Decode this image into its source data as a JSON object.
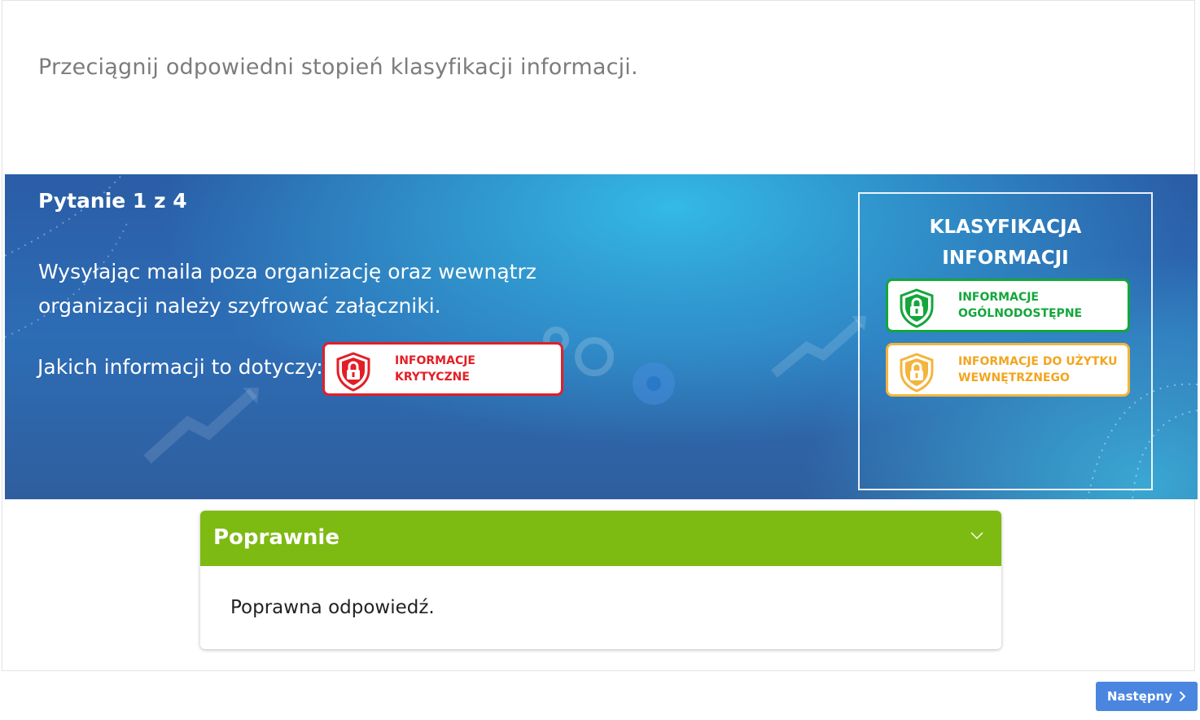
{
  "instruction": "Przeciągnij odpowiedni stopień klasyfikacji informacji.",
  "question": {
    "title": "Pytanie 1 z 4",
    "text": "Wysyłając maila poza organizację oraz wewnątrz organizacji należy szyfrować załączniki.",
    "ask": "Jakich informacji to dotyczy:"
  },
  "dropped_answer": {
    "line1": "INFORMACJE",
    "line2": "KRYTYCZNE",
    "color": "#e41e26",
    "icon": "lock-shield-icon"
  },
  "classification_panel": {
    "title_line1": "KLASYFIKACJA",
    "title_line2": "INFORMACJI",
    "options": [
      {
        "line1": "INFORMACJE",
        "line2": "OGÓLNODOSTĘPNE",
        "color": "#14a63c",
        "icon": "lock-shield-icon"
      },
      {
        "line1": "INFORMACJE DO UŻYTKU",
        "line2": "WEWNĘTRZNEGO",
        "color": "#f3a51e",
        "icon": "lock-shield-icon"
      }
    ]
  },
  "feedback": {
    "title": "Poprawnie",
    "body": "Poprawna odpowiedź.",
    "color": "#7dba12"
  },
  "navigation": {
    "next_label": "Następny"
  }
}
